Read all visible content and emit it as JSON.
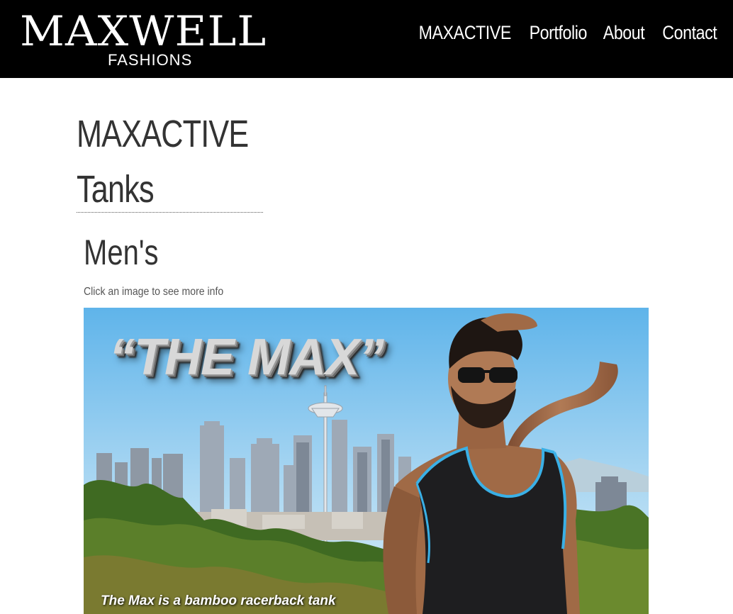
{
  "header": {
    "logo": {
      "word": "MAXWELL",
      "sub": "FASHIONS"
    },
    "nav": [
      {
        "label": "MAXACTIVE"
      },
      {
        "label": "Portfolio"
      },
      {
        "label": "About"
      },
      {
        "label": "Contact"
      }
    ]
  },
  "main": {
    "title_lines": [
      "MAXACTIVE",
      "Tanks"
    ],
    "section_heading": "Men's",
    "hint": "Click an image to see more info",
    "product": {
      "promo_title": "“THE MAX”",
      "caption": "The Max is a bamboo racerback tank"
    }
  },
  "colors": {
    "header_bg": "#000000",
    "text": "#333333",
    "sky": "#7fc3ec",
    "tank": "#1e1e20",
    "tank_trim": "#3ab0e6"
  },
  "icons": {
    "logo": "maxwell-fashions-logo"
  }
}
